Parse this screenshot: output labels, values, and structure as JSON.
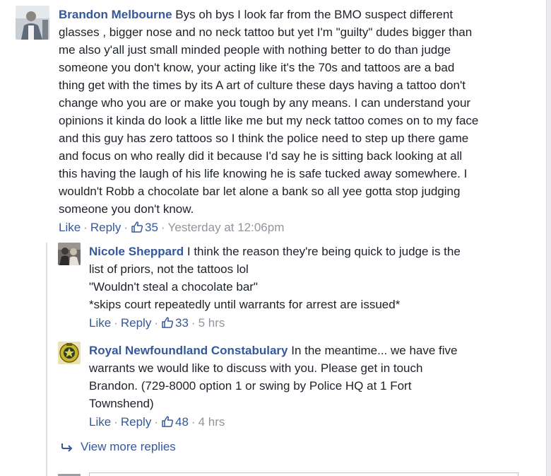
{
  "colors": {
    "link": "#365899",
    "muted": "#90949c",
    "text": "#1d2129",
    "rail": "#dddfe2"
  },
  "comments": [
    {
      "author": "Brandon Melbourne",
      "avatar_icon": "profile-photo-icon",
      "lines": [
        "Bys oh bys I look far from the BMO suspect different",
        "glasses , bigger nose and no neck tattoo but yet I'm \"guilty\" dudes bigger than",
        "me also y'all just small minded people with nothing better to do than judge",
        "someone you don't know, your acting like it's the 70s and tattoos are a bad",
        "thing get with the times by its A art of culture these days having a tattoo don't",
        "change who you are or make you tough by any means. I can understand your",
        "opinions it kinda do look a little like me but my neck tattoo comes on to my face",
        "and this guy has zero tattoos so I think the police need to step up there game",
        "and focus on who really did it because I'd say he is sitting back looking at all",
        "this having the laugh of his life knowing he is safe tucked away somewhere. I",
        "wouldn't Robb a chocolate bar let alone a bank so all yee gotta stop judging",
        "someone you don't know."
      ],
      "like_label": "Like",
      "reply_label": "Reply",
      "likes": "35",
      "time": "Yesterday at 12:06pm"
    },
    {
      "author": "Nicole Sheppard",
      "avatar_icon": "profile-photo-icon",
      "lines": [
        "I think the reason they're being quick to judge is the",
        "list of priors, not the tattoos lol",
        "\"Wouldn't steal a chocolate bar\"",
        "*skips court repeatedly until warrants for arrest are issued*"
      ],
      "like_label": "Like",
      "reply_label": "Reply",
      "likes": "33",
      "time": "5 hrs"
    },
    {
      "author": "Royal Newfoundland Constabulary",
      "avatar_icon": "police-crest-icon",
      "lines": [
        "In the meantime... we have five",
        "warrants we would like to discuss with you. Please get in touch",
        "Brandon. (729-8000 option 1 or swing by Police HQ at 1 Fort",
        "Townshend)"
      ],
      "like_label": "Like",
      "reply_label": "Reply",
      "likes": "48",
      "time": "4 hrs"
    }
  ],
  "view_more": {
    "label": "View more replies",
    "icon": "reply-arrow-icon"
  }
}
